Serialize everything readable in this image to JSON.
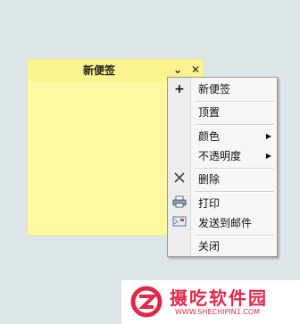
{
  "note": {
    "title": "新便签",
    "collapse_icon": "chevron-down-icon",
    "close_icon": "close-icon",
    "color": "#fef9a0"
  },
  "context_menu": {
    "items": [
      {
        "label": "新便签",
        "icon": "plus-icon"
      },
      {
        "label": "顶置"
      },
      {
        "label": "颜色",
        "submenu": true
      },
      {
        "label": "不透明度",
        "submenu": true
      },
      {
        "label": "删除",
        "icon": "delete-x-icon"
      },
      {
        "label": "打印",
        "icon": "printer-icon"
      },
      {
        "label": "发送到邮件",
        "icon": "mail-icon"
      },
      {
        "label": "关闭"
      }
    ]
  },
  "watermark": {
    "name": "摄吃软件园",
    "url": "WWW.SHECHIPIN1.COM",
    "color": "#e0294a"
  }
}
